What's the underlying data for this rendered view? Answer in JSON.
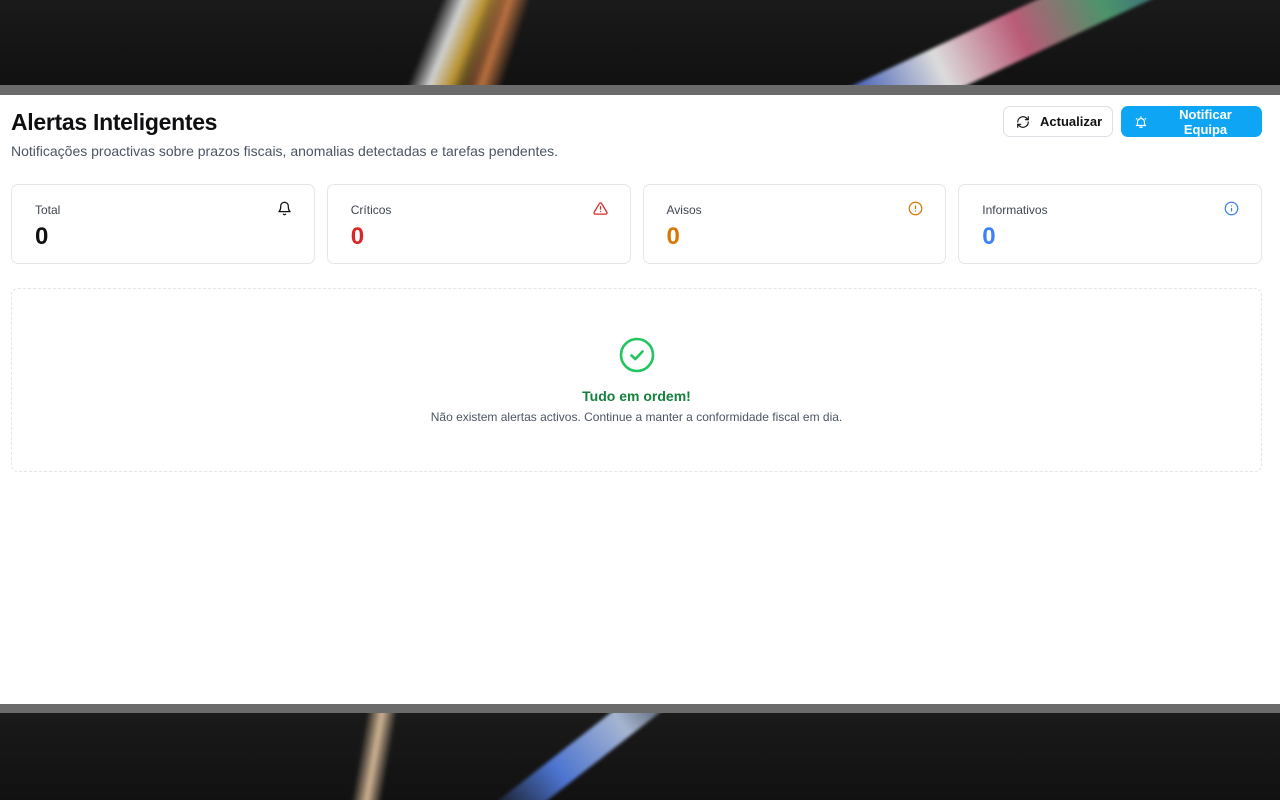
{
  "header": {
    "title": "Alertas Inteligentes",
    "subtitle": "Notificações proactivas sobre prazos fiscais, anomalias detectadas e tarefas pendentes."
  },
  "actions": {
    "refresh_label": "Actualizar",
    "notify_label": "Notificar Equipa"
  },
  "stats": [
    {
      "label": "Total",
      "value": "0",
      "color": "#111111",
      "icon": "bell-icon"
    },
    {
      "label": "Críticos",
      "value": "0",
      "color": "#dc2626",
      "icon": "alert-triangle-icon"
    },
    {
      "label": "Avisos",
      "value": "0",
      "color": "#d97706",
      "icon": "alert-circle-icon"
    },
    {
      "label": "Informativos",
      "value": "0",
      "color": "#3b82f6",
      "icon": "info-icon"
    }
  ],
  "empty_state": {
    "icon": "check-circle-icon",
    "title": "Tudo em ordem!",
    "description": "Não existem alertas activos. Continue a manter a conformidade fiscal em dia."
  },
  "colors": {
    "accent": "#0ea5f4",
    "success": "#22c55e"
  }
}
